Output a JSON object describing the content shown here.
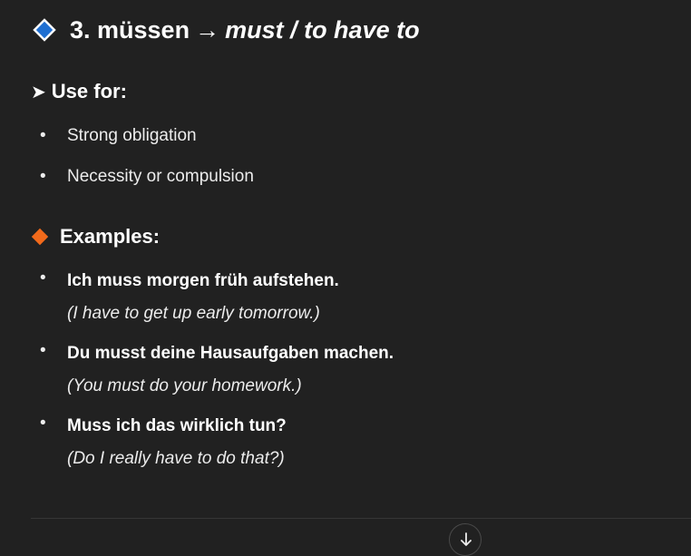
{
  "heading": {
    "number_word": "3. müssen",
    "arrow": "→",
    "translation": "must / to have to"
  },
  "use_for": {
    "arrow_glyph": "➤",
    "title": "Use for:",
    "items": [
      "Strong obligation",
      "Necessity or compulsion"
    ]
  },
  "examples": {
    "title": "Examples:",
    "items": [
      {
        "de": "Ich muss morgen früh aufstehen.",
        "en": "(I have to get up early tomorrow.)"
      },
      {
        "de": "Du musst deine Hausaufgaben machen.",
        "en": "(You must do your homework.)"
      },
      {
        "de": "Muss ich das wirklich tun?",
        "en": "(Do I really have to do that?)"
      }
    ]
  },
  "bullet_glyph": "•",
  "icons": {
    "heading_icon": "blue-diamond-icon",
    "examples_icon": "orange-diamond-icon",
    "scroll_icon": "arrow-down-icon"
  },
  "colors": {
    "background": "#212121",
    "blue_diamond": "#1f6fd1",
    "orange_diamond": "#f26a1b"
  }
}
